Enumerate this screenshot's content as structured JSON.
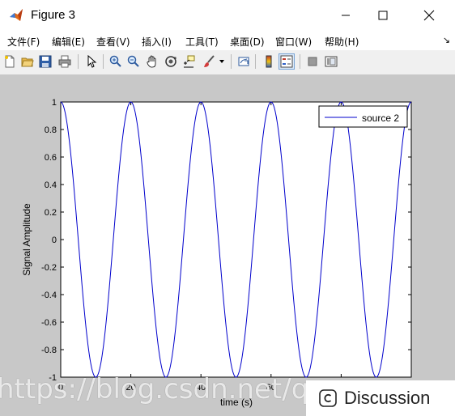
{
  "window": {
    "title": "Figure 3",
    "controls": [
      "minimize",
      "maximize",
      "close"
    ]
  },
  "menu": {
    "items": [
      "文件(F)",
      "编辑(E)",
      "查看(V)",
      "插入(I)",
      "工具(T)",
      "桌面(D)",
      "窗口(W)",
      "帮助(H)"
    ],
    "overflow_glyph": "↘"
  },
  "toolbar": {
    "icons": [
      "new-figure-icon",
      "open-file-icon",
      "save-icon",
      "print-icon",
      "pointer-icon",
      "zoom-in-icon",
      "zoom-out-icon",
      "pan-hand-icon",
      "rotate-3d-icon",
      "data-cursor-icon",
      "brush-icon",
      "dropdown-arrow-icon",
      "link-plot-icon",
      "colorbar-icon",
      "legend-icon",
      "hide-plot-tools-icon",
      "show-plot-tools-icon"
    ],
    "pressed": "legend-icon"
  },
  "chart_data": {
    "type": "line",
    "title": "",
    "xlabel": "time (s)",
    "ylabel": "Signal Amplitude",
    "ylim": [
      -1,
      1
    ],
    "yticks": [
      "1",
      "0.8",
      "0.6",
      "0.4",
      "0.2",
      "0",
      "-0.2",
      "-0.4",
      "-0.6",
      "-0.8",
      "-1"
    ],
    "xticks_visible": [
      "0",
      "20",
      "40",
      "60",
      "80"
    ],
    "series": [
      {
        "name": "source 2",
        "color": "#0000cc",
        "function": "cosine",
        "period_x_units": 20,
        "amplitude": 1,
        "x_range": [
          0,
          100
        ]
      }
    ],
    "legend": {
      "position": "top-right",
      "entries": [
        "source 2"
      ]
    },
    "grid": false
  },
  "overlay": {
    "watermark": "https://blog.csdn.net/qq_",
    "discussion_label": "Discussion"
  },
  "colors": {
    "figure_background": "#c8c8c8",
    "line": "#0000cc",
    "toolbar_background": "#f0f0f0"
  }
}
